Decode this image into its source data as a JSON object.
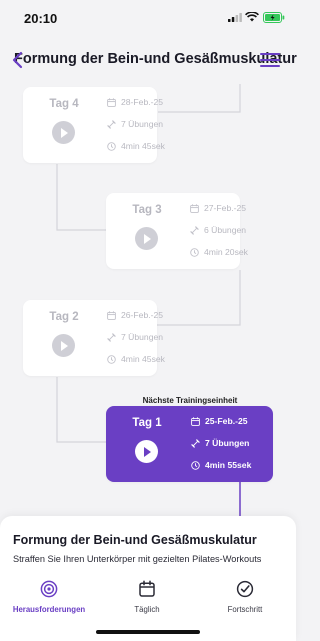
{
  "status_bar": {
    "time": "20:10"
  },
  "header": {
    "title": "Formung der Bein-und Gesäßmuskulatur"
  },
  "days": [
    {
      "tag": "Tag 4",
      "date": "28-Feb.-25",
      "exercises": "7 Übungen",
      "duration": "4min 45sek",
      "state": "locked"
    },
    {
      "tag": "Tag 3",
      "date": "27-Feb.-25",
      "exercises": "6 Übungen",
      "duration": "4min 20sek",
      "state": "locked"
    },
    {
      "tag": "Tag 2",
      "date": "26-Feb.-25",
      "exercises": "7 Übungen",
      "duration": "4min 45sek",
      "state": "locked"
    },
    {
      "tag": "Tag 1",
      "date": "25-Feb.-25",
      "exercises": "7 Übungen",
      "duration": "4min 55sek",
      "state": "next"
    }
  ],
  "next_label": "Nächste Trainingseinheit",
  "sheet": {
    "title": "Formung der Bein-und Gesäßmuskulatur",
    "subtitle": "Straffen Sie Ihren Unterkörper mit gezielten Pilates-Workouts"
  },
  "tabs": [
    {
      "label": "Herausforderungen",
      "icon": "target-icon",
      "active": true
    },
    {
      "label": "Täglich",
      "icon": "calendar-icon",
      "active": false
    },
    {
      "label": "Fortschritt",
      "icon": "progress-icon",
      "active": false
    }
  ],
  "colors": {
    "accent": "#6a3fc4",
    "inactive_text": "#b8b8c0",
    "background": "#f3f3f5"
  }
}
